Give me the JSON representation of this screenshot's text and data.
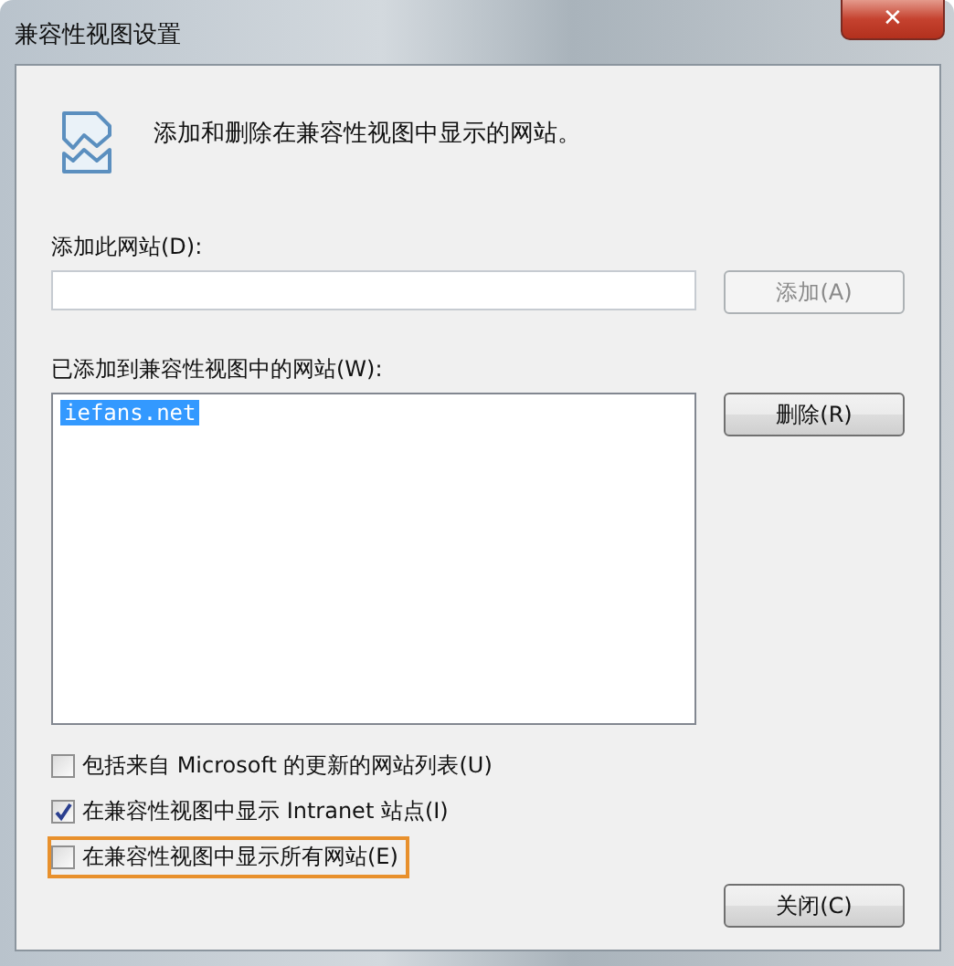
{
  "window": {
    "title": "兼容性视图设置",
    "close": "✕"
  },
  "header": {
    "text": "添加和删除在兼容性视图中显示的网站。"
  },
  "add_site": {
    "label": "添加此网站(D):",
    "button": {
      "label": "添加(A)",
      "disabled": true
    }
  },
  "site_list": {
    "label": "已添加到兼容性视图中的网站(W):",
    "items": [
      {
        "text": "iefans.net",
        "selected": true
      }
    ],
    "button": {
      "label": "删除(R)",
      "disabled": false
    }
  },
  "options": [
    {
      "label": "包括来自 Microsoft 的更新的网站列表(U)",
      "checked": false,
      "highlighted": false
    },
    {
      "label": "在兼容性视图中显示 Intranet 站点(I)",
      "checked": true,
      "highlighted": false
    },
    {
      "label": "在兼容性视图中显示所有网站(E)",
      "checked": false,
      "highlighted": true
    }
  ],
  "close_button": {
    "label": "关闭(C)"
  }
}
